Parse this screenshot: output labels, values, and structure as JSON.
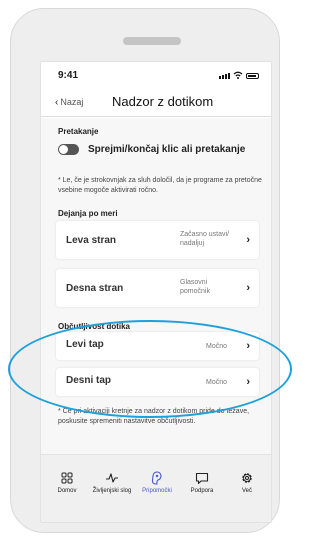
{
  "status_bar": {
    "time": "9:41"
  },
  "nav": {
    "back_label": "Nazaj",
    "title": "Nadzor z dotikom"
  },
  "streaming": {
    "section_label": "Pretakanje",
    "toggle_label": "Sprejmi/končaj klic ali pretakanje",
    "toggle_on": false,
    "note": "* Le, če je strokovnjak za sluh določil, da je programe za pretočne vsebine mogoče aktivirati ročno."
  },
  "custom_actions": {
    "section_label": "Dejanja po meri",
    "items": [
      {
        "label": "Leva stran",
        "value": "Začasno ustavi/ nadaljuj"
      },
      {
        "label": "Desna stran",
        "value": "Glasovni pomočnik"
      }
    ]
  },
  "sensitivity": {
    "section_label": "Občutljivost dotika",
    "items": [
      {
        "label": "Levi tap",
        "value": "Močno"
      },
      {
        "label": "Desni tap",
        "value": "Močno"
      }
    ],
    "note": "* Če pri aktivaciji kretnje za nadzor z dotikom pride do težave, poskusite spremeniti nastavitve občutljivosti."
  },
  "tabbar": {
    "active": "Pripomočki",
    "items": [
      {
        "label": "Domov",
        "icon": "grid-icon"
      },
      {
        "label": "Življenjski slog",
        "icon": "activity-icon"
      },
      {
        "label": "Pripomočki",
        "icon": "hearing-aid-icon"
      },
      {
        "label": "Podpora",
        "icon": "chat-bubble-icon"
      },
      {
        "label": "Več",
        "icon": "gear-icon"
      }
    ]
  },
  "colors": {
    "accent": "#4a59c8",
    "highlight_ring": "#1ea0dc",
    "background": "#f7f7f7"
  }
}
